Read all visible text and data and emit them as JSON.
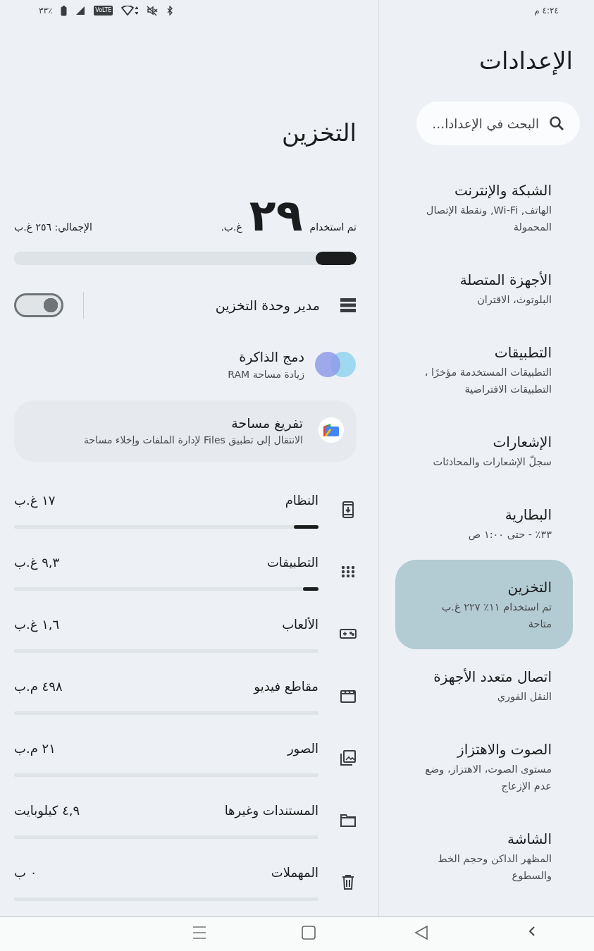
{
  "status_bar": {
    "battery_percent": "٣٣٪",
    "network_badge": "VoLTE",
    "time": "٤:٢٤ م"
  },
  "settings": {
    "title": "الإعدادات",
    "search": {
      "placeholder": "البحث في الإعدادا…"
    },
    "items": [
      {
        "title": "الشبكة والإنترنت",
        "subtitle": "الهاتف, Wi-Fi, ونقطة الإتصال المحمولة",
        "selected": false
      },
      {
        "title": "الأجهزة المتصلة",
        "subtitle": "البلوتوث، الاقتران",
        "selected": false
      },
      {
        "title": "التطبيقات",
        "subtitle": "التطبيقات المستخدمة مؤخرًا ، التطبيقات الافتراضية",
        "selected": false
      },
      {
        "title": "الإشعارات",
        "subtitle": "سجلّ الإشعارات والمحادثات",
        "selected": false
      },
      {
        "title": "البطارية",
        "subtitle": "٣٣٪ - حتى ١:٠٠ ص",
        "selected": false
      },
      {
        "title": "التخزين",
        "subtitle": "تم استخدام ١١٪ ٢٢٧ غ.ب متاحة",
        "selected": true
      },
      {
        "title": "اتصال متعدد الأجهزة",
        "subtitle": "النقل الفوري",
        "selected": false
      },
      {
        "title": "الصوت والاهتزاز",
        "subtitle": "مستوى الصوت، الاهتزاز، وضع عدم الإزعاج",
        "selected": false
      },
      {
        "title": "الشاشة",
        "subtitle": "المظهر الداكن وحجم الخط والسطوع",
        "selected": false
      }
    ]
  },
  "storage": {
    "title": "التخزين",
    "used_label": "تم استخدام",
    "used_value": "٢٩",
    "used_unit": "غ.ب.",
    "total": "الإجمالي: ٢٥٦ غ.ب",
    "level": 0.12,
    "storage_manager": {
      "label": "مدير وحدة التخزين",
      "checked": false
    },
    "memory_merge": {
      "title": "دمج الذاكرة",
      "subtitle": "زيادة مساحة RAM"
    },
    "free_up": {
      "title": "تفريغ مساحة",
      "subtitle": "الانتقال إلى تطبيق Files لإدارة الملفات وإخلاء مساحة"
    },
    "categories": [
      {
        "kind": "system",
        "label": "النظام",
        "value": "١٧ غ.ب",
        "level": 0.08
      },
      {
        "kind": "apps",
        "label": "التطبيقات",
        "value": "٩,٣ غ.ب",
        "level": 0.05
      },
      {
        "kind": "games",
        "label": "الألعاب",
        "value": "١,٦ غ.ب",
        "level": 0
      },
      {
        "kind": "videos",
        "label": "مقاطع فيديو",
        "value": "٤٩٨ م.ب",
        "level": 0
      },
      {
        "kind": "images",
        "label": "الصور",
        "value": "٢١ م.ب",
        "level": 0
      },
      {
        "kind": "documents",
        "label": "المستندات وغيرها",
        "value": "٤,٩ كيلوبايت",
        "level": 0
      },
      {
        "kind": "trash",
        "label": "المهملات",
        "value": "٠ ب",
        "level": 0
      }
    ]
  }
}
